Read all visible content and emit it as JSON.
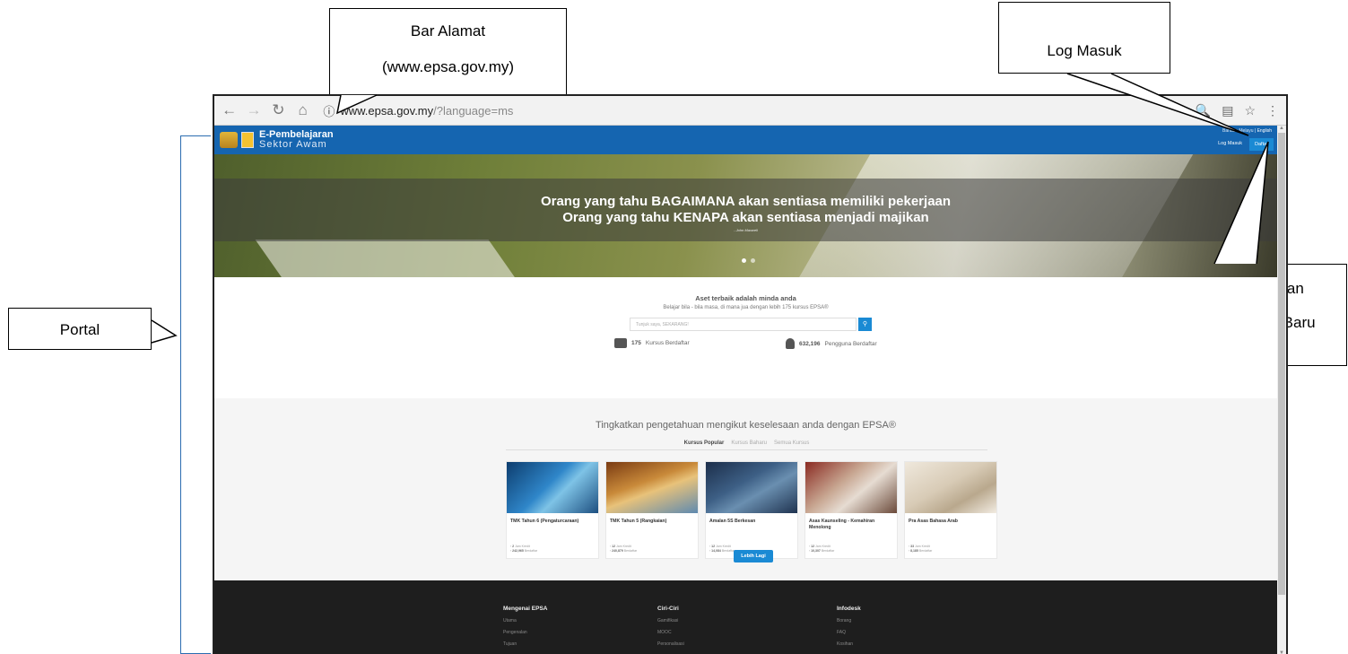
{
  "callouts": {
    "address_bar_title": "Bar Alamat",
    "address_bar_url": "(www.epsa.gov.my)",
    "login": "Log Masuk",
    "register_line1": "Pendaftaran",
    "register_line2": "Pengguna Baru",
    "portal": "Portal"
  },
  "browser": {
    "url_host": "www.",
    "url_host_rest": "epsa.gov.my",
    "url_path": "/?language=ms"
  },
  "site": {
    "brand_line1": "E-Pembelajaran",
    "brand_line2": "Sektor Awam",
    "lang_malay": "Bahasa Melayu",
    "lang_sep": "|",
    "lang_english": "English",
    "login_label": "Log Masuk",
    "signup_label": "Daftar",
    "hero": {
      "quote_line1": "Orang yang tahu BAGAIMANA akan sentiasa memiliki pekerjaan",
      "quote_line2": "Orang yang tahu KENAPA akan sentiasa menjadi majikan",
      "author": "- John Maxwell"
    },
    "intro": {
      "heading": "Aset terbaik adalah minda anda",
      "subheading": "Belajar bila - bila masa, di mana jua dengan lebih 175 kursus EPSA®",
      "search_placeholder": "Tunjuk saya, SEKARANG!",
      "search_icon": "search-icon",
      "courses_count": "175",
      "courses_label": "Kursus Berdaftar",
      "users_count": "632,196",
      "users_label": "Pengguna Berdaftar"
    },
    "courses": {
      "title": "Tingkatkan pengetahuan mengikut keselesaan anda dengan EPSA®",
      "tabs": [
        "Kursus Popular",
        "Kursus Baharu",
        "Semua Kursus"
      ],
      "cards": [
        {
          "name": "TMK Tahun 6 (Pengaturcaraan)",
          "hours": "2",
          "hours_label": "Jam Kredit",
          "enrolled": "242,965",
          "enrolled_label": "Berdaftar"
        },
        {
          "name": "TMK Tahun 5 (Rangkaian)",
          "hours": "12",
          "hours_label": "Jam Kredit",
          "enrolled": "240,879",
          "enrolled_label": "Berdaftar"
        },
        {
          "name": "Amalan 5S Berkesan",
          "hours": "12",
          "hours_label": "Jam Kredit",
          "enrolled": "14,084",
          "enrolled_label": "Berdaftar"
        },
        {
          "name": "Asas Kaunseling - Kemahiran Menolong",
          "hours": "12",
          "hours_label": "Jam Kredit",
          "enrolled": "10,307",
          "enrolled_label": "Berdaftar"
        },
        {
          "name": "Pra Asas Bahasa Arab",
          "hours": "33",
          "hours_label": "Jam Kredit",
          "enrolled": "8,185",
          "enrolled_label": "Berdaftar"
        }
      ],
      "more_button": "Lebih Lagi"
    },
    "footer": {
      "col1_title": "Mengenai EPSA",
      "col1_items": [
        "Utama",
        "Pengenalan",
        "Tujuan"
      ],
      "col2_title": "Ciri-Ciri",
      "col2_items": [
        "Gamifikasi",
        "MOOC",
        "Personalisasi"
      ],
      "col3_title": "Infodesk",
      "col3_items": [
        "Borang",
        "FAQ",
        "Kosihan"
      ]
    }
  },
  "colors": {
    "nav_blue": "#1565b0",
    "accent_blue": "#1a8ad4",
    "footer_bg": "#1e1e1e",
    "bracket_blue": "#2b6cb0"
  }
}
